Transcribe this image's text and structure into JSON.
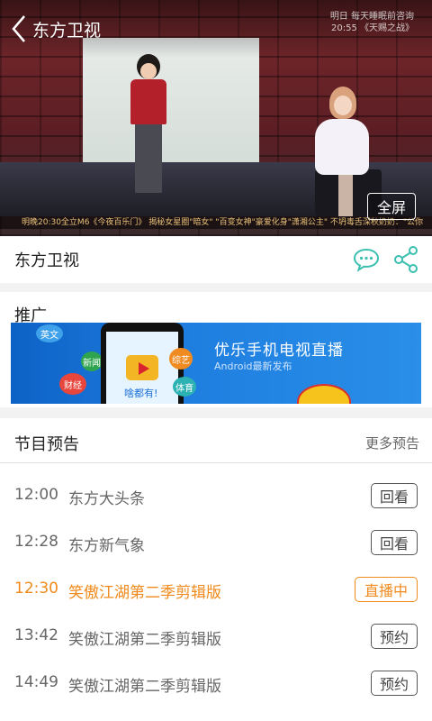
{
  "header": {
    "title": "东方卫视",
    "osd_line1": "明日 每天睡眠前咨询",
    "osd_line2": "20:55 《天赐之战》",
    "ticker": "明晚20:30全立M6《今夜百乐门》    揭秘女星圈\"暗女\"    \"百变女神\"豪爱化身\"潇湘公主\"    不坍毒舌深秋奶奶：\"公你"
  },
  "player": {
    "fullscreen_label": "全屏"
  },
  "channel": {
    "name": "东方卫视",
    "icons": [
      "chat-bubble-icon",
      "share-icon"
    ]
  },
  "promo": {
    "title": "推广",
    "banner_title": "优乐手机电视直播",
    "banner_subtitle": "Android最新发布",
    "banner_phone_text": "啥都有!",
    "banner_tags": [
      "英文",
      "新闻",
      "财经",
      "综艺",
      "体育"
    ]
  },
  "schedule": {
    "title": "节目预告",
    "more_label": "更多预告",
    "programs": [
      {
        "time": "12:00",
        "name": "东方大头条",
        "action": "回看"
      },
      {
        "time": "12:28",
        "name": "东方新气象",
        "action": "回看"
      },
      {
        "time": "12:30",
        "name": "笑傲江湖第二季剪辑版",
        "action": "直播中"
      },
      {
        "time": "13:42",
        "name": "笑傲江湖第二季剪辑版",
        "action": "预约"
      },
      {
        "time": "14:49",
        "name": "笑傲江湖第二季剪辑版",
        "action": "预约"
      }
    ]
  },
  "colors": {
    "accent_live": "#f08a1c",
    "icon_teal": "#3bbfb0",
    "banner_blue": "#1f7fe0"
  }
}
